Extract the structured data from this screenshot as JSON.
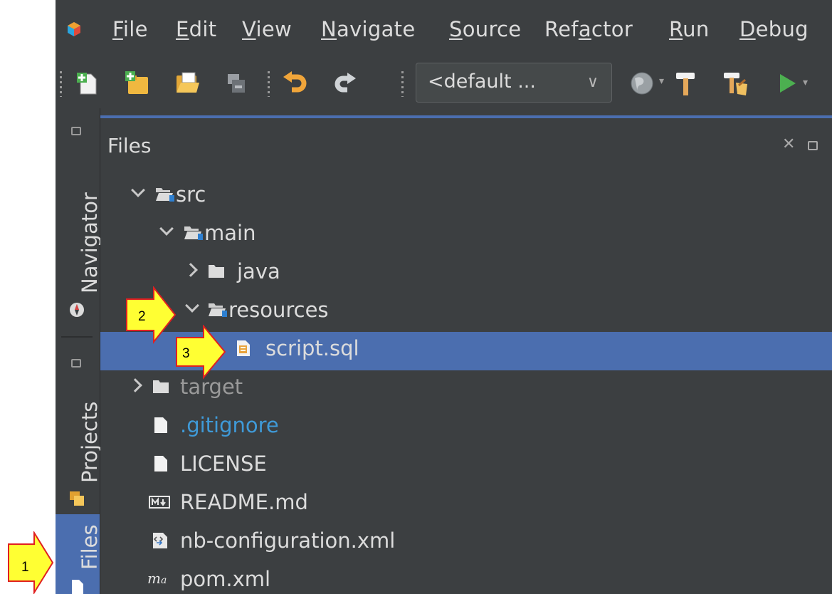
{
  "menu": {
    "items": [
      {
        "label": "File",
        "mnemonic": "F",
        "rest": "ile"
      },
      {
        "label": "Edit",
        "mnemonic": "E",
        "rest": "dit"
      },
      {
        "label": "View",
        "mnemonic": "V",
        "rest": "iew"
      },
      {
        "label": "Navigate",
        "mnemonic": "N",
        "rest": "avigate"
      },
      {
        "label": "Source",
        "mnemonic": "S",
        "rest": "ource"
      },
      {
        "label": "Refactor",
        "pre": "Ref",
        "mnemonic": "a",
        "rest": "ctor"
      },
      {
        "label": "Run",
        "mnemonic": "R",
        "rest": "un"
      },
      {
        "label": "Debug",
        "mnemonic": "D",
        "rest": "ebug"
      }
    ]
  },
  "toolbar": {
    "config_value": "<default ...",
    "icons": [
      "new-file-icon",
      "new-project-icon",
      "open-project-icon",
      "close-project-icon",
      "undo-icon",
      "redo-icon",
      "globe-icon",
      "build-icon",
      "clean-build-icon",
      "run-icon"
    ]
  },
  "sidebar": {
    "tabs": [
      {
        "label": "Navigator",
        "icon": "compass-icon",
        "active": false
      },
      {
        "label": "Projects",
        "icon": "projects-icon",
        "active": false
      },
      {
        "label": "Files",
        "icon": "files-icon",
        "active": true
      }
    ]
  },
  "panel": {
    "title": "Files",
    "tree": [
      {
        "name": "src",
        "type": "folder-open-source",
        "expanded": true,
        "depth": 0
      },
      {
        "name": "main",
        "type": "folder-open-source",
        "expanded": true,
        "depth": 1
      },
      {
        "name": "java",
        "type": "folder",
        "expanded": false,
        "depth": 2
      },
      {
        "name": "resources",
        "type": "folder-open-source",
        "expanded": true,
        "depth": 2
      },
      {
        "name": "script.sql",
        "type": "sql-file",
        "depth": 3,
        "selected": true
      },
      {
        "name": "target",
        "type": "folder",
        "expanded": false,
        "depth": 0,
        "dimmed": true
      },
      {
        "name": ".gitignore",
        "type": "file",
        "depth": 0,
        "git": true
      },
      {
        "name": "LICENSE",
        "type": "file",
        "depth": 0
      },
      {
        "name": "README.md",
        "type": "markdown-file",
        "depth": 0
      },
      {
        "name": "nb-configuration.xml",
        "type": "xml-file",
        "depth": 0
      },
      {
        "name": "pom.xml",
        "type": "maven-file",
        "depth": 0
      }
    ]
  },
  "callouts": [
    {
      "number": "1",
      "color": "#ffff33"
    },
    {
      "number": "2",
      "color": "#ffff33"
    },
    {
      "number": "3",
      "color": "#ffff33"
    }
  ]
}
